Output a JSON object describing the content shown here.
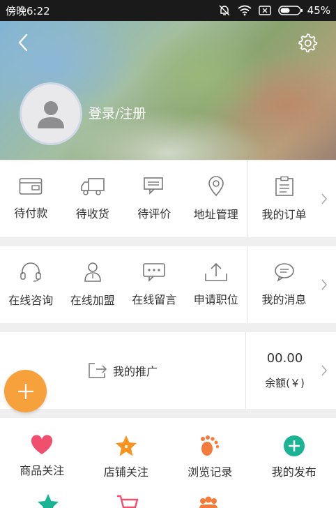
{
  "status_bar": {
    "time": "傍晚6:22",
    "battery": "45%"
  },
  "header": {
    "login_label": "登录/注册"
  },
  "orders": {
    "items": [
      {
        "label": "待付款",
        "icon": "wallet-icon"
      },
      {
        "label": "待收货",
        "icon": "truck-icon"
      },
      {
        "label": "待评价",
        "icon": "comment-icon"
      },
      {
        "label": "地址管理",
        "icon": "location-icon"
      }
    ],
    "right": {
      "label": "我的订单",
      "icon": "clipboard-icon"
    }
  },
  "services": {
    "items": [
      {
        "label": "在线咨询",
        "icon": "headset-icon"
      },
      {
        "label": "在线加盟",
        "icon": "person-icon"
      },
      {
        "label": "在线留言",
        "icon": "message-icon"
      },
      {
        "label": "申请职位",
        "icon": "upload-icon"
      }
    ],
    "right": {
      "label": "我的消息",
      "icon": "chat-icon"
    }
  },
  "promotion": {
    "label": "我的推广",
    "balance_value": "00.00",
    "balance_label": "余额(￥)"
  },
  "shortcuts": [
    {
      "label": "商品关注",
      "icon": "heart-icon",
      "color": "#f0506e"
    },
    {
      "label": "店铺关注",
      "icon": "star-icon",
      "color": "#f7931e"
    },
    {
      "label": "浏览记录",
      "icon": "footprint-icon",
      "color": "#f47b39"
    },
    {
      "label": "我的发布",
      "icon": "plus-circle-icon",
      "color": "#1ab394"
    }
  ],
  "colors": {
    "accent": "#f7a13c",
    "divider": "#efefef"
  }
}
